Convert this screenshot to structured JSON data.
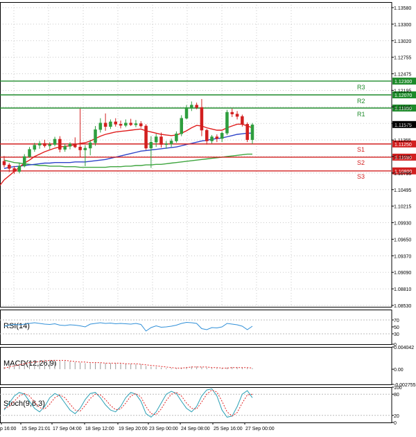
{
  "chart_data": {
    "type": "candlestick",
    "colors": {
      "bull": "#2e9e3e",
      "bear": "#d21f1f",
      "ma_fast": "#e01b1b",
      "ma_slow": "#2d43c8",
      "ma_long": "#3ea53e",
      "resistance": "#1d8a2a",
      "support": "#d21f1f",
      "rsi": "#2f8fd8",
      "macd_hist": "#9a9a9a",
      "macd_signal": "#e02020",
      "stoch_main": "#2aa0b5",
      "stoch_signal": "#e02020"
    },
    "price_axis": {
      "ylim": [
        1.0853,
        1.1362
      ],
      "ticks": [
        "1.13580",
        "1.13300",
        "1.13020",
        "1.12755",
        "1.12475",
        "1.12195",
        "1.11915",
        "1.11635",
        "1.11355",
        "1.11075",
        "1.10795",
        "1.10495",
        "1.10215",
        "1.09930",
        "1.09650",
        "1.09370",
        "1.09090",
        "1.08810",
        "1.08530"
      ],
      "grid": true
    },
    "time_axis": {
      "labels": [
        "p 16:00",
        "15 Sep 21:01",
        "17 Sep 04:00",
        "18 Sep 12:00",
        "19 Sep 20:00",
        "23 Sep 00:00",
        "24 Sep 08:00",
        "25 Sep 16:00",
        "27 Sep 00:00"
      ]
    },
    "levels": [
      {
        "name": "R3",
        "value": 1.123,
        "label": "1.12300",
        "kind": "resistance"
      },
      {
        "name": "R2",
        "value": 1.1207,
        "label": "1.12070",
        "kind": "resistance"
      },
      {
        "name": "R1",
        "value": 1.1185,
        "label": "1.11850",
        "kind": "resistance"
      },
      {
        "name": "S1",
        "value": 1.1125,
        "label": "1.11250",
        "kind": "support"
      },
      {
        "name": "S2",
        "value": 1.1103,
        "label": "1.11030",
        "kind": "support"
      },
      {
        "name": "S3",
        "value": 1.108,
        "label": "1.10800",
        "kind": "support"
      }
    ],
    "current_price": {
      "value": 1.11575,
      "label": "1.11575"
    },
    "candles": [
      {
        "o": 1.1096,
        "h": 1.1105,
        "l": 1.1086,
        "c": 1.109
      },
      {
        "o": 1.109,
        "h": 1.1093,
        "l": 1.1078,
        "c": 1.1084
      },
      {
        "o": 1.1084,
        "h": 1.1088,
        "l": 1.1075,
        "c": 1.1079
      },
      {
        "o": 1.1079,
        "h": 1.1094,
        "l": 1.1076,
        "c": 1.1088
      },
      {
        "o": 1.1088,
        "h": 1.1108,
        "l": 1.1086,
        "c": 1.1104
      },
      {
        "o": 1.1104,
        "h": 1.112,
        "l": 1.1102,
        "c": 1.1116
      },
      {
        "o": 1.1116,
        "h": 1.1127,
        "l": 1.1112,
        "c": 1.1123
      },
      {
        "o": 1.1123,
        "h": 1.113,
        "l": 1.1117,
        "c": 1.1126
      },
      {
        "o": 1.1126,
        "h": 1.1132,
        "l": 1.1119,
        "c": 1.1122
      },
      {
        "o": 1.1122,
        "h": 1.1128,
        "l": 1.1116,
        "c": 1.1124
      },
      {
        "o": 1.1124,
        "h": 1.1137,
        "l": 1.1121,
        "c": 1.1133
      },
      {
        "o": 1.1133,
        "h": 1.1138,
        "l": 1.1111,
        "c": 1.1116
      },
      {
        "o": 1.1116,
        "h": 1.1125,
        "l": 1.1112,
        "c": 1.1121
      },
      {
        "o": 1.1121,
        "h": 1.1128,
        "l": 1.1116,
        "c": 1.1125
      },
      {
        "o": 1.1125,
        "h": 1.1136,
        "l": 1.1118,
        "c": 1.112
      },
      {
        "o": 1.112,
        "h": 1.1184,
        "l": 1.1103,
        "c": 1.1115
      },
      {
        "o": 1.1115,
        "h": 1.1123,
        "l": 1.1088,
        "c": 1.1118
      },
      {
        "o": 1.1118,
        "h": 1.1132,
        "l": 1.1106,
        "c": 1.1127
      },
      {
        "o": 1.1127,
        "h": 1.1155,
        "l": 1.1122,
        "c": 1.1149
      },
      {
        "o": 1.1149,
        "h": 1.1168,
        "l": 1.1144,
        "c": 1.116
      },
      {
        "o": 1.116,
        "h": 1.1176,
        "l": 1.1147,
        "c": 1.1154
      },
      {
        "o": 1.1154,
        "h": 1.1166,
        "l": 1.115,
        "c": 1.1162
      },
      {
        "o": 1.1162,
        "h": 1.1168,
        "l": 1.1154,
        "c": 1.1158
      },
      {
        "o": 1.1158,
        "h": 1.1164,
        "l": 1.1151,
        "c": 1.1156
      },
      {
        "o": 1.1156,
        "h": 1.1166,
        "l": 1.1153,
        "c": 1.116
      },
      {
        "o": 1.116,
        "h": 1.1167,
        "l": 1.1155,
        "c": 1.1157
      },
      {
        "o": 1.1157,
        "h": 1.1165,
        "l": 1.1153,
        "c": 1.1159
      },
      {
        "o": 1.1159,
        "h": 1.1163,
        "l": 1.1152,
        "c": 1.1155
      },
      {
        "o": 1.1155,
        "h": 1.1158,
        "l": 1.1115,
        "c": 1.1118
      },
      {
        "o": 1.1118,
        "h": 1.1138,
        "l": 1.1085,
        "c": 1.1128
      },
      {
        "o": 1.1128,
        "h": 1.1142,
        "l": 1.112,
        "c": 1.1137
      },
      {
        "o": 1.1137,
        "h": 1.1144,
        "l": 1.1119,
        "c": 1.1124
      },
      {
        "o": 1.1124,
        "h": 1.113,
        "l": 1.1117,
        "c": 1.1125
      },
      {
        "o": 1.1125,
        "h": 1.1134,
        "l": 1.112,
        "c": 1.113
      },
      {
        "o": 1.113,
        "h": 1.1146,
        "l": 1.1127,
        "c": 1.1142
      },
      {
        "o": 1.1142,
        "h": 1.1173,
        "l": 1.1138,
        "c": 1.1168
      },
      {
        "o": 1.1168,
        "h": 1.119,
        "l": 1.1166,
        "c": 1.1186
      },
      {
        "o": 1.1186,
        "h": 1.1196,
        "l": 1.118,
        "c": 1.119
      },
      {
        "o": 1.119,
        "h": 1.1194,
        "l": 1.1183,
        "c": 1.1186
      },
      {
        "o": 1.1186,
        "h": 1.12,
        "l": 1.1138,
        "c": 1.1148
      },
      {
        "o": 1.1148,
        "h": 1.115,
        "l": 1.1124,
        "c": 1.113
      },
      {
        "o": 1.113,
        "h": 1.114,
        "l": 1.1126,
        "c": 1.1137
      },
      {
        "o": 1.1137,
        "h": 1.1141,
        "l": 1.1128,
        "c": 1.1134
      },
      {
        "o": 1.1134,
        "h": 1.1146,
        "l": 1.1128,
        "c": 1.1143
      },
      {
        "o": 1.1143,
        "h": 1.1182,
        "l": 1.114,
        "c": 1.1178
      },
      {
        "o": 1.1178,
        "h": 1.1184,
        "l": 1.117,
        "c": 1.1175
      },
      {
        "o": 1.1175,
        "h": 1.118,
        "l": 1.1166,
        "c": 1.1171
      },
      {
        "o": 1.1171,
        "h": 1.1174,
        "l": 1.1154,
        "c": 1.1158
      },
      {
        "o": 1.1158,
        "h": 1.1161,
        "l": 1.1128,
        "c": 1.1132
      },
      {
        "o": 1.1132,
        "h": 1.116,
        "l": 1.1125,
        "c": 1.1157
      }
    ],
    "ma_fast": [
      1.1065,
      1.1072,
      1.1079,
      1.1086,
      1.1093,
      1.1098,
      1.1104,
      1.1108,
      1.1112,
      1.1115,
      1.1118,
      1.112,
      1.1121,
      1.1122,
      1.1124,
      1.1126,
      1.1127,
      1.113,
      1.1134,
      1.1138,
      1.1141,
      1.1143,
      1.1145,
      1.1146,
      1.1147,
      1.1148,
      1.1149,
      1.115,
      1.1147,
      1.1145,
      1.1143,
      1.1141,
      1.114,
      1.1139,
      1.114,
      1.1143,
      1.1147,
      1.1152,
      1.1156,
      1.1155,
      1.1152,
      1.115,
      1.1148,
      1.1148,
      1.1152,
      1.1155,
      1.1158,
      1.1158,
      1.1155,
      1.1152
    ],
    "ma_slow": [
      1.1084,
      1.1086,
      1.1087,
      1.1088,
      1.1089,
      1.109,
      1.1091,
      1.1092,
      1.1093,
      1.1093,
      1.1094,
      1.1094,
      1.1094,
      1.1094,
      1.1095,
      1.1095,
      1.1095,
      1.1096,
      1.1097,
      1.1098,
      1.1099,
      1.1101,
      1.1103,
      1.1105,
      1.1107,
      1.1109,
      1.1111,
      1.1113,
      1.1114,
      1.1115,
      1.1116,
      1.1117,
      1.1118,
      1.1119,
      1.112,
      1.1122,
      1.1124,
      1.1126,
      1.1128,
      1.113,
      1.1131,
      1.1133,
      1.1134,
      1.1135,
      1.1137,
      1.1139,
      1.1141,
      1.1142,
      1.1143,
      1.1143
    ],
    "ma_long": [
      1.1098,
      1.1096,
      1.1094,
      1.1093,
      1.1092,
      1.1091,
      1.109,
      1.1089,
      1.1089,
      1.1088,
      1.1088,
      1.1088,
      1.1087,
      1.1087,
      1.1087,
      1.1086,
      1.1086,
      1.1086,
      1.1086,
      1.1086,
      1.1086,
      1.1087,
      1.1087,
      1.1087,
      1.1088,
      1.1088,
      1.1089,
      1.1089,
      1.109,
      1.109,
      1.1091,
      1.1091,
      1.1092,
      1.1093,
      1.1094,
      1.1095,
      1.1096,
      1.1097,
      1.1098,
      1.1099,
      1.11,
      1.1101,
      1.1102,
      1.1103,
      1.1104,
      1.1105,
      1.1106,
      1.1107,
      1.1108,
      1.1108
    ],
    "rsi": {
      "label": "RSI(14)",
      "ylim": [
        0,
        100
      ],
      "ticks": [
        "70",
        "50",
        "30",
        "0"
      ],
      "levels": [
        70,
        30
      ],
      "values": [
        52,
        55,
        57,
        56,
        58,
        60,
        62,
        60,
        58,
        57,
        59,
        55,
        54,
        56,
        55,
        53,
        50,
        58,
        60,
        62,
        60,
        61,
        59,
        60,
        59,
        58,
        60,
        57,
        38,
        48,
        53,
        49,
        50,
        52,
        55,
        60,
        63,
        62,
        60,
        45,
        42,
        48,
        47,
        50,
        60,
        58,
        56,
        52,
        42,
        52
      ]
    },
    "macd": {
      "label": "MACD(12,26,9)",
      "ylim": [
        -0.002755,
        0.004042
      ],
      "ticks": [
        "0.004042",
        "0.00",
        "-0.002755"
      ],
      "hist": [
        0.0004,
        0.0006,
        0.0008,
        0.001,
        0.0012,
        0.0014,
        0.0015,
        0.0016,
        0.0017,
        0.0017,
        0.0017,
        0.0016,
        0.0015,
        0.0014,
        0.0013,
        0.0012,
        0.0011,
        0.0011,
        0.0011,
        0.0011,
        0.0011,
        0.0011,
        0.0011,
        0.001,
        0.001,
        0.001,
        0.0009,
        0.0009,
        0.0006,
        0.0005,
        0.0004,
        0.0003,
        0.0002,
        0.0002,
        0.0002,
        0.0003,
        0.0004,
        0.0005,
        0.0005,
        0.0004,
        0.0003,
        0.0002,
        0.0002,
        0.0002,
        0.0003,
        0.0004,
        0.0004,
        0.0003,
        0.0002,
        0.0002
      ],
      "signal": [
        0.0002,
        0.0004,
        0.0006,
        0.0008,
        0.001,
        0.0012,
        0.0013,
        0.0014,
        0.0015,
        0.0016,
        0.0016,
        0.0016,
        0.0016,
        0.0015,
        0.0014,
        0.0013,
        0.0013,
        0.0012,
        0.0012,
        0.0012,
        0.0011,
        0.0011,
        0.0011,
        0.0011,
        0.001,
        0.001,
        0.001,
        0.0009,
        0.0008,
        0.0007,
        0.0006,
        0.0005,
        0.0004,
        0.0003,
        0.0002,
        0.0002,
        0.0003,
        0.0004,
        0.0004,
        0.0004,
        0.0004,
        0.0003,
        0.0003,
        0.0002,
        0.0002,
        0.0003,
        0.0003,
        0.0003,
        0.0003,
        0.0002
      ]
    },
    "stoch": {
      "label": "Stoch(9,6,3)",
      "ylim": [
        0,
        100
      ],
      "ticks": [
        "100",
        "80",
        "20",
        "0"
      ],
      "levels": [
        80,
        20
      ],
      "main": [
        35,
        55,
        75,
        85,
        80,
        60,
        40,
        30,
        45,
        70,
        82,
        75,
        55,
        35,
        25,
        40,
        65,
        82,
        85,
        70,
        50,
        35,
        30,
        45,
        70,
        85,
        80,
        60,
        25,
        15,
        30,
        55,
        80,
        88,
        82,
        60,
        40,
        30,
        45,
        75,
        92,
        95,
        75,
        35,
        15,
        18,
        45,
        80,
        90,
        70
      ],
      "signal": [
        40,
        45,
        60,
        75,
        82,
        75,
        58,
        42,
        38,
        52,
        70,
        78,
        70,
        52,
        35,
        32,
        48,
        68,
        80,
        78,
        65,
        48,
        36,
        38,
        55,
        75,
        82,
        72,
        45,
        25,
        22,
        38,
        62,
        80,
        85,
        75,
        55,
        40,
        38,
        58,
        80,
        92,
        86,
        60,
        30,
        18,
        28,
        55,
        78,
        80
      ]
    }
  }
}
